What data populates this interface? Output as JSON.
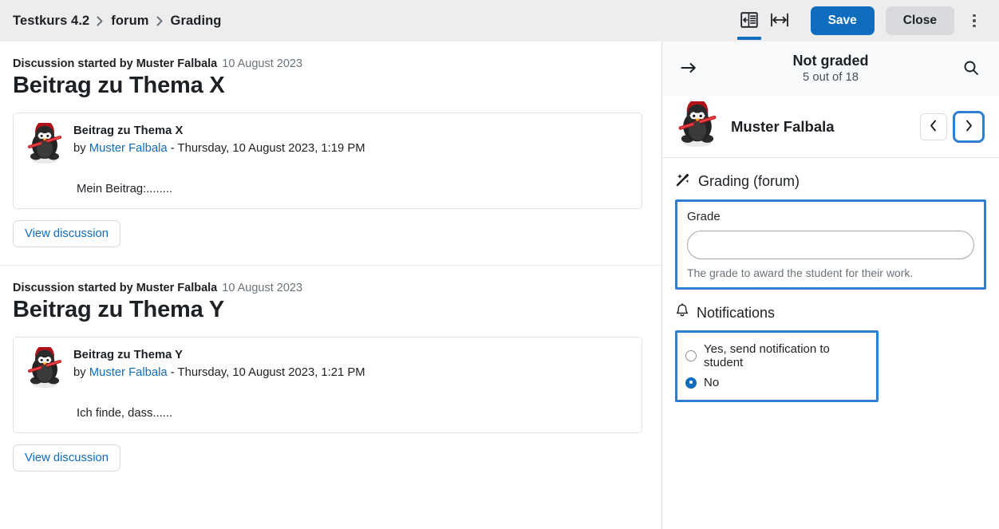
{
  "breadcrumb": {
    "items": [
      {
        "label": "Testkurs 4.2"
      },
      {
        "label": "forum"
      },
      {
        "label": "Grading"
      }
    ]
  },
  "toolbar": {
    "collapse_panel_icon": "panel-collapse-icon",
    "resize_icon": "horizontal-resize-icon",
    "save_label": "Save",
    "close_label": "Close",
    "menu_icon": "kebab-menu-icon",
    "accent_color": "#0f6cbf"
  },
  "main": {
    "discussions": [
      {
        "started_by_prefix": "Discussion started by Muster Falbala",
        "date": "10 August 2023",
        "title": "Beitrag zu Thema X",
        "post": {
          "subject": "Beitrag zu Thema X",
          "by_word": "by",
          "author": "Muster Falbala",
          "separator": "-",
          "timestamp": "Thursday, 10 August 2023, 1:19 PM",
          "body": "Mein Beitrag:........"
        },
        "view_label": "View discussion"
      },
      {
        "started_by_prefix": "Discussion started by Muster Falbala",
        "date": "10 August 2023",
        "title": "Beitrag zu Thema Y",
        "post": {
          "subject": "Beitrag zu Thema Y",
          "by_word": "by",
          "author": "Muster Falbala",
          "separator": "-",
          "timestamp": "Thursday, 10 August 2023, 1:21 PM",
          "body": "Ich finde, dass......"
        },
        "view_label": "View discussion"
      }
    ]
  },
  "panel": {
    "back_icon": "arrow-right-icon",
    "status": "Not graded",
    "count": "5 out of 18",
    "search_icon": "search-icon",
    "user": {
      "name": "Muster Falbala",
      "avatar_icon": "user-avatar-penguin",
      "prev_icon": "chevron-left-icon",
      "next_icon": "chevron-right-icon"
    },
    "grading": {
      "icon": "magic-wand-icon",
      "title": "Grading (forum)",
      "grade_label": "Grade",
      "grade_value": "",
      "grade_placeholder": "",
      "grade_help": "The grade to award the student for their work."
    },
    "notifications": {
      "icon": "bell-icon",
      "title": "Notifications",
      "options": [
        {
          "label": "Yes, send notification to student",
          "selected": false
        },
        {
          "label": "No",
          "selected": true
        }
      ]
    },
    "highlight_color": "#2f7fd1"
  }
}
